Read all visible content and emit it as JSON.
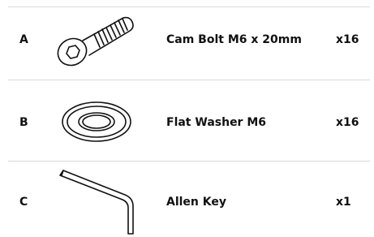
{
  "parts": [
    {
      "letter": "A",
      "name": "Cam Bolt M6 x 20mm",
      "quantity": "x16",
      "icon": "cam-bolt-icon"
    },
    {
      "letter": "B",
      "name": "Flat Washer M6",
      "quantity": "x16",
      "icon": "flat-washer-icon"
    },
    {
      "letter": "C",
      "name": "Allen Key",
      "quantity": "x1",
      "icon": "allen-key-icon"
    }
  ],
  "colors": {
    "text": "#111111",
    "line": "#d9d9d9",
    "divider": "#d9d9d9"
  }
}
